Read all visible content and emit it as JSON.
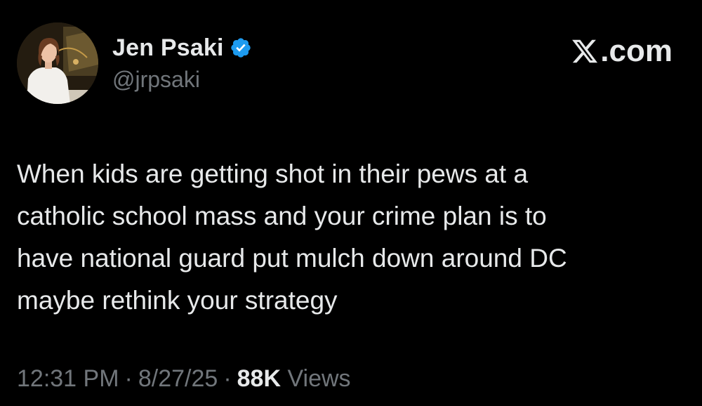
{
  "author": {
    "display_name": "Jen Psaki",
    "handle": "@jrpsaki",
    "verified": true,
    "verified_icon": "verified-badge-icon",
    "verified_color": "#1d9bf0"
  },
  "brand": {
    "icon": "x-logo-icon",
    "suffix": ".com"
  },
  "tweet": {
    "lines": [
      "When kids are getting shot in their pews at a",
      "catholic school mass and your crime plan is to",
      "have national guard put mulch down around DC",
      "maybe rethink your strategy"
    ]
  },
  "meta": {
    "time": "12:31 PM",
    "separator": "·",
    "date": "8/27/25",
    "views_count": "88K",
    "views_label": "Views"
  },
  "colors": {
    "background": "#000000",
    "text_primary": "#e7e9ea",
    "text_secondary": "#71767b"
  }
}
